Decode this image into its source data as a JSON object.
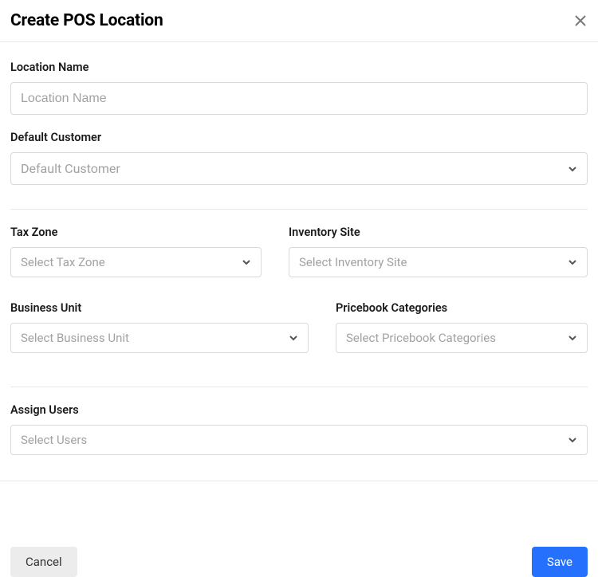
{
  "header": {
    "title": "Create POS Location"
  },
  "form": {
    "locationName": {
      "label": "Location Name",
      "placeholder": "Location Name",
      "value": ""
    },
    "defaultCustomer": {
      "label": "Default Customer",
      "placeholder": "Default Customer",
      "value": ""
    },
    "taxZone": {
      "label": "Tax Zone",
      "placeholder": "Select Tax Zone",
      "value": ""
    },
    "inventorySite": {
      "label": "Inventory Site",
      "placeholder": "Select Inventory Site",
      "value": ""
    },
    "businessUnit": {
      "label": "Business Unit",
      "placeholder": "Select Business Unit",
      "value": ""
    },
    "pricebookCategories": {
      "label": "Pricebook Categories",
      "placeholder": "Select Pricebook Categories",
      "value": ""
    },
    "assignUsers": {
      "label": "Assign Users",
      "placeholder": "Select Users",
      "value": ""
    }
  },
  "footer": {
    "cancel": "Cancel",
    "save": "Save"
  }
}
